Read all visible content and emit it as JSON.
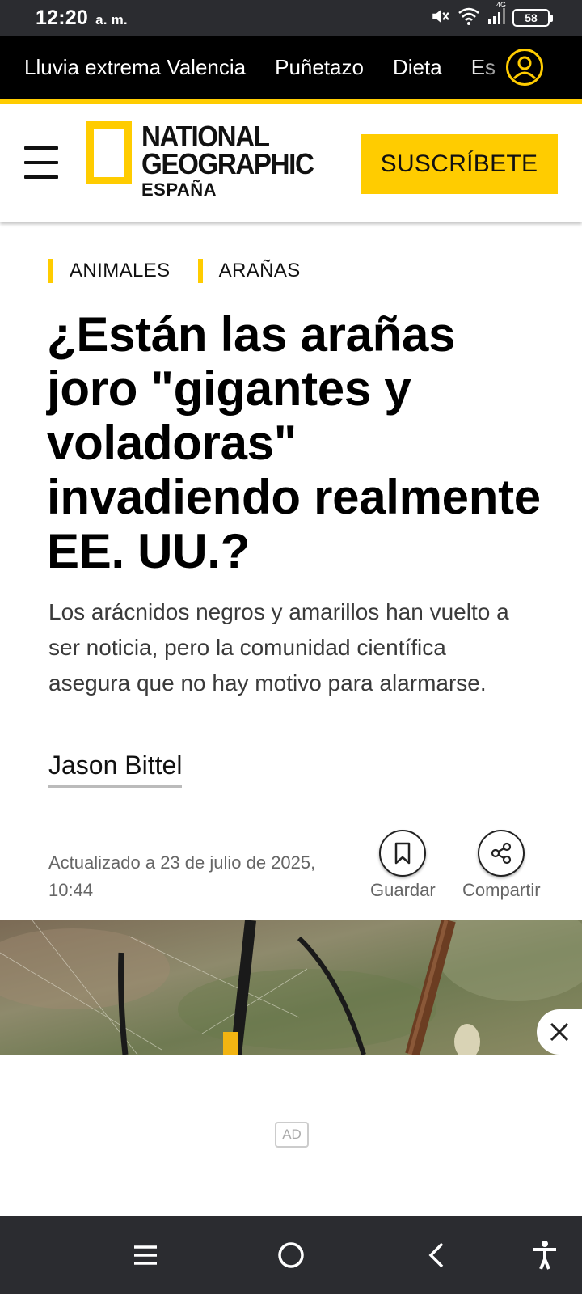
{
  "status_bar": {
    "time": "12:20",
    "ampm": "a. m.",
    "network": "4G",
    "battery": "58"
  },
  "trending": {
    "items": [
      "Lluvia extrema Valencia",
      "Puñetazo",
      "Dieta",
      "Es"
    ]
  },
  "header": {
    "logo_line1": "NATIONAL",
    "logo_line2": "GEOGRAPHIC",
    "logo_line3": "ESPAÑA",
    "subscribe_label": "SUSCRÍBETE"
  },
  "article": {
    "categories": [
      "ANIMALES",
      "ARAÑAS"
    ],
    "headline": "¿Están las arañas joro \"gigantes y voladoras\" invadiendo realmente EE. UU.?",
    "dek": "Los arácnidos negros y amarillos han vuelto a ser noticia, pero la comunidad científica asegura que no hay motivo para alarmarse.",
    "author": "Jason Bittel",
    "date": "Actualizado a 23 de julio de 2025, 10:44",
    "save_label": "Guardar",
    "share_label": "Compartir"
  },
  "ad": {
    "badge": "AD"
  },
  "colors": {
    "brand_yellow": "#ffcc00",
    "system_bar": "#2b2c30",
    "trend_bar": "#000000"
  },
  "icons": [
    "mute-icon",
    "wifi-icon",
    "signal-icon",
    "battery-icon",
    "user-icon",
    "menu-icon",
    "bookmark-icon",
    "share-icon",
    "close-icon",
    "recents-icon",
    "home-icon",
    "back-icon",
    "accessibility-icon"
  ]
}
